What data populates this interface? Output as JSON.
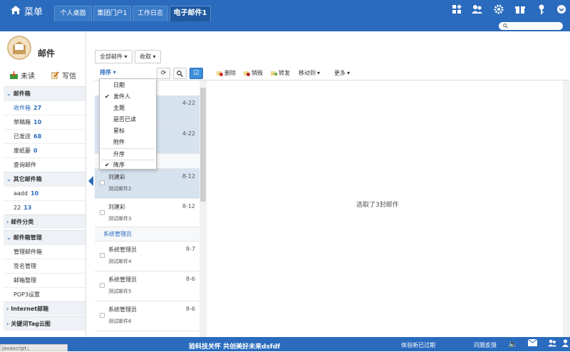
{
  "header": {
    "menu_label": "菜单",
    "tabs": [
      {
        "label": "个人桌面"
      },
      {
        "label": "集团门户1"
      },
      {
        "label": "工作日志"
      },
      {
        "label": "电子邮件1"
      }
    ],
    "icons": [
      "grid-plus-icon",
      "users-icon",
      "gear-icon",
      "gift-icon",
      "key-icon",
      "chevron-down-circle-icon"
    ],
    "search_placeholder": ""
  },
  "sidebar": {
    "title": "邮件",
    "unread_label": "未读",
    "write_label": "写信",
    "sections": [
      {
        "label": "邮件箱"
      },
      {
        "label": "其它邮件箱"
      },
      {
        "label": "邮件分类"
      },
      {
        "label": "邮件箱管理"
      },
      {
        "label": "Internet邮箱"
      },
      {
        "label": "关键词Tag云图"
      }
    ],
    "mailbox_items": [
      {
        "label": "收件箱",
        "count": "27"
      },
      {
        "label": "草稿箱",
        "count": "10"
      },
      {
        "label": "已发送",
        "count": "68"
      },
      {
        "label": "废纸篓",
        "count": "0"
      },
      {
        "label": "查询邮件",
        "count": ""
      }
    ],
    "other_items": [
      {
        "label": "aadd",
        "count": "10"
      },
      {
        "label": "22",
        "count": "13"
      }
    ],
    "manage_items": [
      {
        "label": "管理邮件箱"
      },
      {
        "label": "签名管理"
      },
      {
        "label": "邮箱整理"
      },
      {
        "label": "POP3设置"
      }
    ]
  },
  "toolbar": {
    "all_mail": "全部邮件",
    "receive": "收取",
    "sort": "排序",
    "delete": "删除",
    "recall": "销毁",
    "forward": "转发",
    "move_to": "移动到",
    "more": "更多"
  },
  "sort_menu": [
    {
      "label": "日期",
      "checked": false
    },
    {
      "label": "发件人",
      "checked": true
    },
    {
      "label": "主题",
      "checked": false
    },
    {
      "label": "是否已读",
      "checked": false
    },
    {
      "label": "星标",
      "checked": false
    },
    {
      "label": "附件",
      "checked": false
    },
    {
      "label": "升序",
      "checked": false
    },
    {
      "label": "降序",
      "checked": true
    }
  ],
  "mail_list": {
    "rows_top": [
      {
        "date": "4-22"
      },
      {
        "date": "4-22"
      }
    ],
    "rows": [
      {
        "sender": "刘建彩",
        "subject": "测试邮件2",
        "date": "8-12"
      },
      {
        "sender": "刘建彩",
        "subject": "测试邮件3",
        "date": "8-12"
      }
    ],
    "group2": "系统管理员",
    "rows2": [
      {
        "sender": "系统管理员",
        "subject": "测试邮件4",
        "date": "8-7"
      },
      {
        "sender": "系统管理员",
        "subject": "测试邮件5",
        "date": "8-6"
      },
      {
        "sender": "系统管理员",
        "subject": "测试邮件6",
        "date": "8-6"
      }
    ]
  },
  "main": {
    "selected_text": "选取了3封邮件"
  },
  "footer": {
    "status": "javascript:;",
    "marquee": "验科技关怀 共创美好未来dsfdf",
    "expire": "体验新已过期",
    "feedback": "问题反馈"
  },
  "colors": {
    "primary": "#2a6bbd",
    "selected_row": "#d6e2ee"
  }
}
